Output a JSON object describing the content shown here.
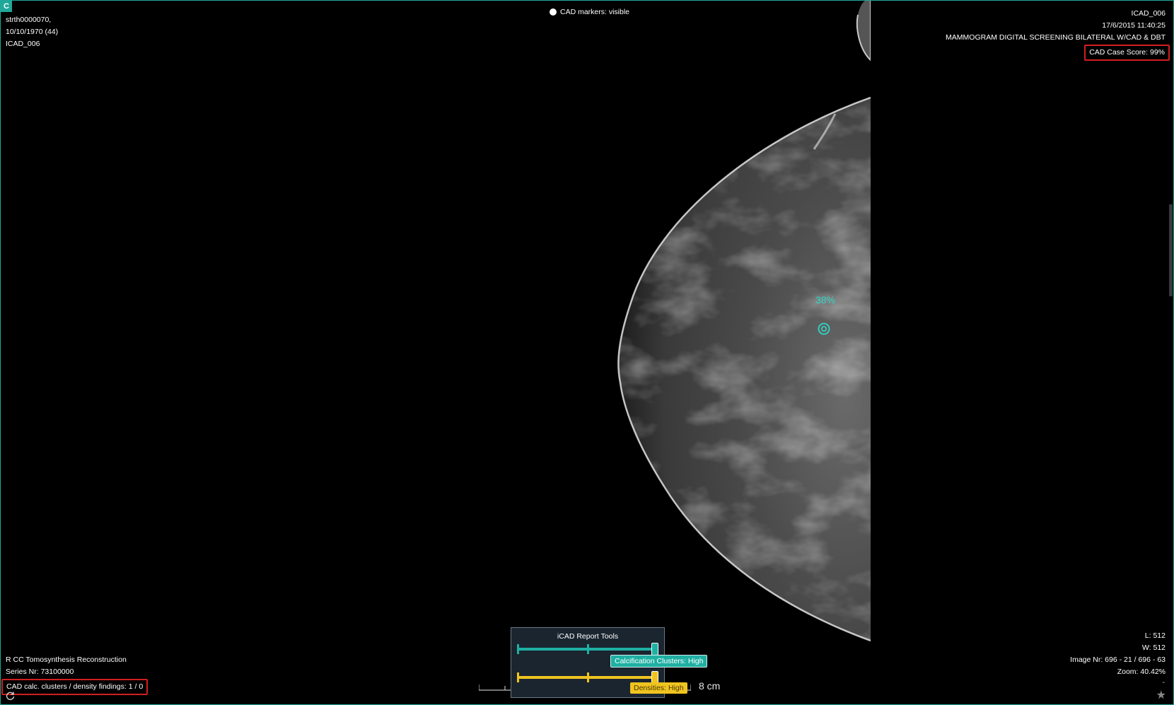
{
  "viewport_badge": "C",
  "patient": {
    "name": "strth0000070,",
    "dob_age": "10/10/1970 (44)",
    "id": "ICAD_006"
  },
  "study": {
    "id": "ICAD_006",
    "datetime": "17/6/2015 11:40:25",
    "description": "MAMMOGRAM DIGITAL SCREENING BILATERAL W/CAD & DBT",
    "cad_case_score": "CAD Case Score: 99%"
  },
  "cad_markers_toggle": "CAD markers: visible",
  "series": {
    "name": "R CC Tomosynthesis Reconstruction",
    "number": "Series Nr: 73100000",
    "cad_findings": "CAD calc. clusters / density findings: 1 / 0"
  },
  "image_info": {
    "level": "L: 512",
    "width": "W: 512",
    "image_nr": "Image Nr: 696 - 21 / 696 - 63",
    "zoom": "Zoom: 40.42%",
    "extra": "-"
  },
  "cad_marker": {
    "percent": "38%",
    "icon": "calcification-cluster-marker-icon"
  },
  "report_tools": {
    "title": "iCAD Report Tools",
    "calcification_label": "Calcification Clusters: High",
    "density_label": "Densities: High",
    "calcification_level": 1.0,
    "density_level": 1.0
  },
  "scale_bar": {
    "label": "8 cm"
  },
  "colors": {
    "accent_teal": "#1fb0a3",
    "accent_yellow": "#f0c420",
    "highlight_red": "#d11f1f",
    "marker_cyan": "#2fd6c4"
  },
  "icons": [
    "sync-icon",
    "star-icon",
    "cad-markers-dot-icon"
  ]
}
